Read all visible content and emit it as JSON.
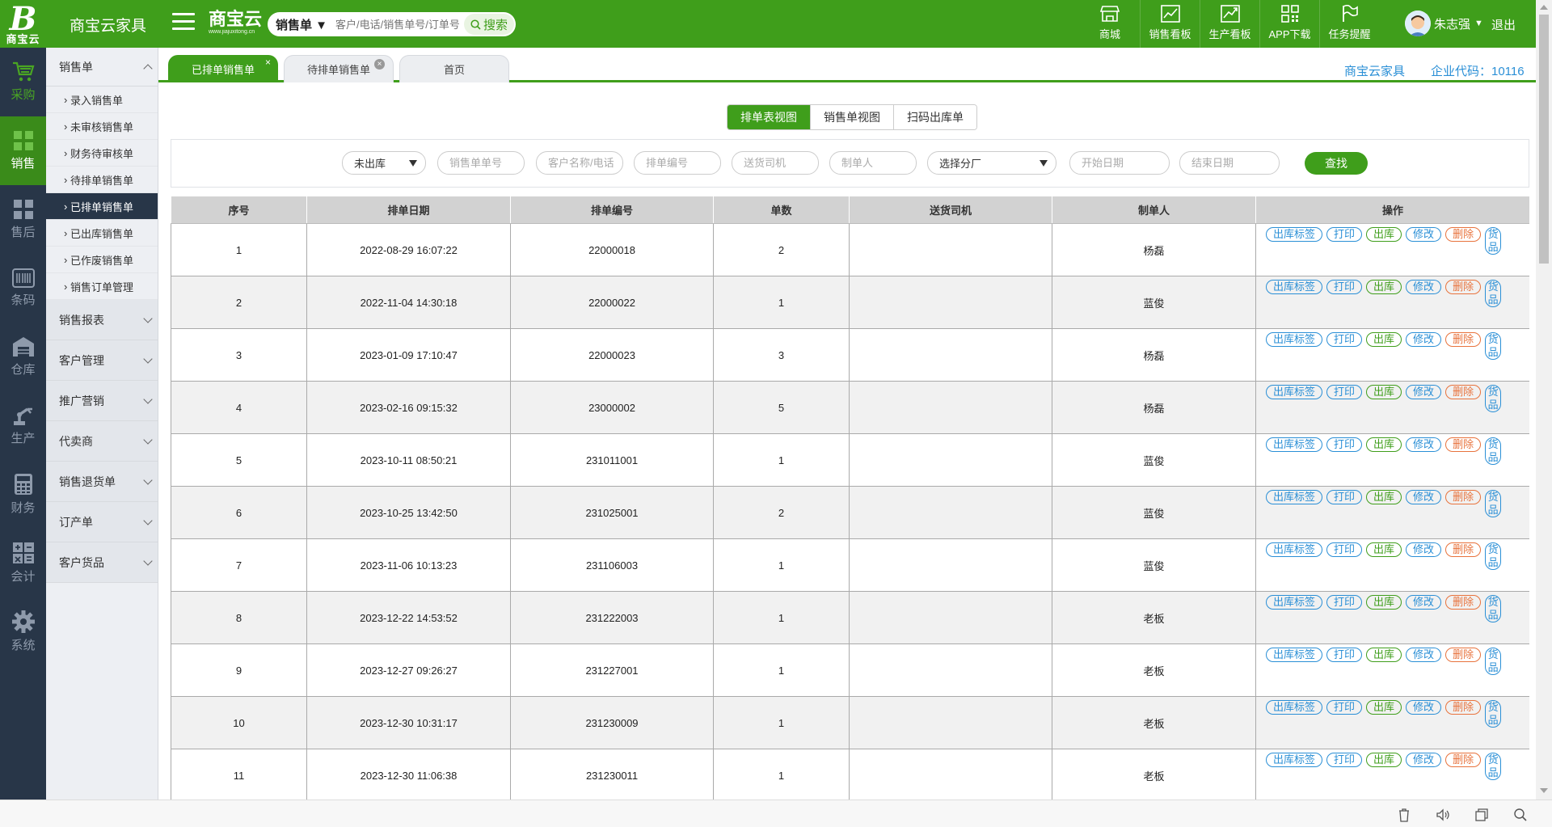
{
  "app": {
    "logo_letter": "B",
    "logo_caption": "商宝云",
    "name": "商宝云家具",
    "brand_name": "商宝云",
    "brand_url": "www.jiajuxitong.cn"
  },
  "search": {
    "type_label": "销售单 ▼",
    "placeholder": "客户/电话/销售单号/订单号",
    "button_label": "搜索"
  },
  "top_nav": [
    {
      "label": "商城",
      "icon": "store-icon"
    },
    {
      "label": "销售看板",
      "icon": "chart-board-icon"
    },
    {
      "label": "生产看板",
      "icon": "production-board-icon"
    },
    {
      "label": "APP下载",
      "icon": "qrcode-icon"
    },
    {
      "label": "任务提醒",
      "icon": "flag-icon"
    }
  ],
  "user": {
    "name": "朱志强",
    "logout": "退出"
  },
  "icon_sidebar": [
    {
      "label": "采购",
      "icon": "cart-icon"
    },
    {
      "label": "销售",
      "icon": "grid-icon"
    },
    {
      "label": "售后",
      "icon": "aftersale-icon"
    },
    {
      "label": "条码",
      "icon": "barcode-icon"
    },
    {
      "label": "仓库",
      "icon": "warehouse-icon"
    },
    {
      "label": "生产",
      "icon": "robot-arm-icon"
    },
    {
      "label": "财务",
      "icon": "calculator-icon"
    },
    {
      "label": "会计",
      "icon": "accounting-icon"
    },
    {
      "label": "系统",
      "icon": "gear-icon"
    }
  ],
  "menu": {
    "open_section": "销售单",
    "sub_items": [
      "录入销售单",
      "未审核销售单",
      "财务待审核单",
      "待排单销售单",
      "已排单销售单",
      "已出库销售单",
      "已作废销售单",
      "销售订单管理"
    ],
    "sections": [
      "销售报表",
      "客户管理",
      "推广营销",
      "代卖商",
      "销售退货单",
      "订产单",
      "客户货品"
    ]
  },
  "tabs": [
    {
      "label": "已排单销售单",
      "close": "×"
    },
    {
      "label": "待排单销售单",
      "close": "×"
    },
    {
      "label": "首页"
    }
  ],
  "company": {
    "name": "商宝云家具",
    "code": "企业代码：10116"
  },
  "view_toggle": [
    "排单表视图",
    "销售单视图",
    "扫码出库单"
  ],
  "filters": {
    "status": "未出库",
    "order_no": "销售单单号",
    "customer": "客户名称/电话",
    "schedule_no": "排单编号",
    "driver": "送货司机",
    "creator": "制单人",
    "factory": "选择分厂",
    "start_date": "开始日期",
    "end_date": "结束日期",
    "find": "查找"
  },
  "table": {
    "headers": [
      "序号",
      "排单日期",
      "排单编号",
      "单数",
      "送货司机",
      "制单人",
      "操作"
    ],
    "rows": [
      [
        "1",
        "2022-08-29 16:07:22",
        "22000018",
        "2",
        "",
        "杨磊"
      ],
      [
        "2",
        "2022-11-04 14:30:18",
        "22000022",
        "1",
        "",
        "蓝俊"
      ],
      [
        "3",
        "2023-01-09 17:10:47",
        "22000023",
        "3",
        "",
        "杨磊"
      ],
      [
        "4",
        "2023-02-16 09:15:32",
        "23000002",
        "5",
        "",
        "杨磊"
      ],
      [
        "5",
        "2023-10-11 08:50:21",
        "231011001",
        "1",
        "",
        "蓝俊"
      ],
      [
        "6",
        "2023-10-25 13:42:50",
        "231025001",
        "2",
        "",
        "蓝俊"
      ],
      [
        "7",
        "2023-11-06 10:13:23",
        "231106003",
        "1",
        "",
        "蓝俊"
      ],
      [
        "8",
        "2023-12-22 14:53:52",
        "231222003",
        "1",
        "",
        "老板"
      ],
      [
        "9",
        "2023-12-27 09:26:27",
        "231227001",
        "1",
        "",
        "老板"
      ],
      [
        "10",
        "2023-12-30 10:31:17",
        "231230009",
        "1",
        "",
        "老板"
      ],
      [
        "11",
        "2023-12-30 11:06:38",
        "231230011",
        "1",
        "",
        "老板"
      ]
    ],
    "actions": [
      {
        "label": "出库标签",
        "color": "blue"
      },
      {
        "label": "打印",
        "color": "blue"
      },
      {
        "label": "出库",
        "color": "green"
      },
      {
        "label": "修改",
        "color": "blue"
      },
      {
        "label": "删除",
        "color": "orange"
      },
      {
        "label": "货品",
        "color": "blue"
      }
    ]
  },
  "colors": {
    "primary": "#3f9e1b",
    "sidebar_dark": "#283648",
    "link_blue": "#2a8fd6",
    "danger_orange": "#e8733d"
  }
}
